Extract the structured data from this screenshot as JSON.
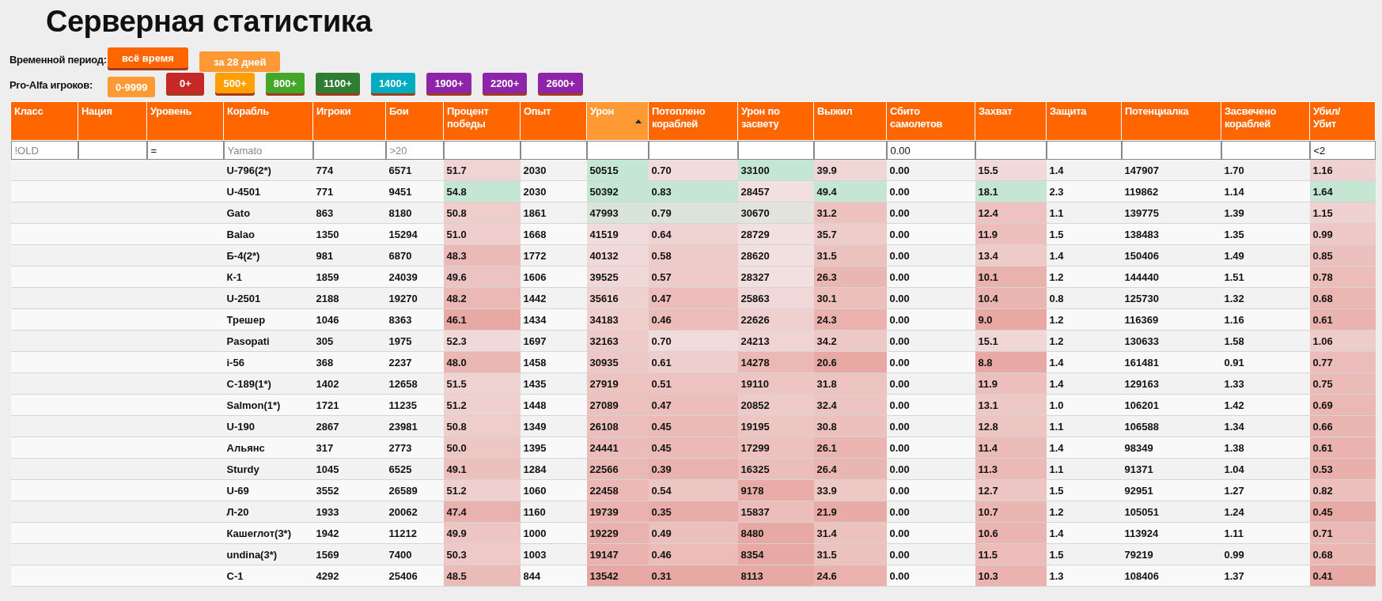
{
  "title": "Серверная статистика",
  "period": {
    "label": "Временной период:",
    "buttons": [
      {
        "label": "всё время",
        "color": "#ff6600",
        "selected": false
      },
      {
        "label": "за 28 дней",
        "color": "#ff9933",
        "selected": true
      }
    ]
  },
  "pro_alfa": {
    "label": "Pro-Alfa игроков:",
    "buttons": [
      {
        "label": "0-9999",
        "color": "#ff9933",
        "selected": true
      },
      {
        "label": "0+",
        "color": "#c62828",
        "selected": false
      },
      {
        "label": "500+",
        "color": "#ffa000",
        "selected": false
      },
      {
        "label": "800+",
        "color": "#43a82a",
        "selected": false
      },
      {
        "label": "1100+",
        "color": "#2e7d32",
        "selected": false
      },
      {
        "label": "1400+",
        "color": "#00acc1",
        "selected": false
      },
      {
        "label": "1900+",
        "color": "#8e24aa",
        "selected": false
      },
      {
        "label": "2200+",
        "color": "#8e24aa",
        "selected": false
      },
      {
        "label": "2600+",
        "color": "#8e24aa",
        "selected": false
      }
    ]
  },
  "table": {
    "columns": [
      {
        "label": "Класс",
        "sorted": false,
        "filter": {
          "placeholder": "!OLD"
        }
      },
      {
        "label": "Нация",
        "sorted": false
      },
      {
        "label": "Уровень",
        "sorted": false,
        "filter": {
          "value": "="
        }
      },
      {
        "label": "Корабль",
        "sorted": false,
        "filter": {
          "placeholder": "Yamato"
        }
      },
      {
        "label": "Игроки",
        "sorted": false
      },
      {
        "label": "Бои",
        "sorted": false,
        "filter": {
          "placeholder": ">20"
        }
      },
      {
        "label": "Процент победы",
        "sorted": false,
        "heatmap": true
      },
      {
        "label": "Опыт",
        "sorted": false
      },
      {
        "label": "Урон",
        "sorted": true,
        "heatmap": true
      },
      {
        "label": "Потоплено кораблей",
        "sorted": false,
        "heatmap": true
      },
      {
        "label": "Урон по засвету",
        "sorted": false,
        "heatmap": true
      },
      {
        "label": "Выжил",
        "sorted": false,
        "heatmap": true
      },
      {
        "label": "Сбито самолетов",
        "sorted": false,
        "filter": {
          "value": "0.00"
        }
      },
      {
        "label": "Захват",
        "sorted": false,
        "heatmap": true
      },
      {
        "label": "Защита",
        "sorted": false
      },
      {
        "label": "Потенциалка",
        "sorted": false
      },
      {
        "label": "Засвечено кораблей",
        "sorted": false
      },
      {
        "label": "Убил/ Убит",
        "sorted": false,
        "heatmap": true,
        "filter": {
          "value": "<2"
        }
      }
    ],
    "rows": [
      [
        "",
        "",
        "",
        "U-796(2*)",
        "774",
        "6571",
        "51.7",
        "2030",
        "50515",
        "0.70",
        "33100",
        "39.9",
        "0.00",
        "15.5",
        "1.4",
        "147907",
        "1.70",
        "1.16"
      ],
      [
        "",
        "",
        "",
        "U-4501",
        "771",
        "9451",
        "54.8",
        "2030",
        "50392",
        "0.83",
        "28457",
        "49.4",
        "0.00",
        "18.1",
        "2.3",
        "119862",
        "1.14",
        "1.64"
      ],
      [
        "",
        "",
        "",
        "Gato",
        "863",
        "8180",
        "50.8",
        "1861",
        "47993",
        "0.79",
        "30670",
        "31.2",
        "0.00",
        "12.4",
        "1.1",
        "139775",
        "1.39",
        "1.15"
      ],
      [
        "",
        "",
        "",
        "Balao",
        "1350",
        "15294",
        "51.0",
        "1668",
        "41519",
        "0.64",
        "28729",
        "35.7",
        "0.00",
        "11.9",
        "1.5",
        "138483",
        "1.35",
        "0.99"
      ],
      [
        "",
        "",
        "",
        "Б-4(2*)",
        "981",
        "6870",
        "48.3",
        "1772",
        "40132",
        "0.58",
        "28620",
        "31.5",
        "0.00",
        "13.4",
        "1.4",
        "150406",
        "1.49",
        "0.85"
      ],
      [
        "",
        "",
        "",
        "К-1",
        "1859",
        "24039",
        "49.6",
        "1606",
        "39525",
        "0.57",
        "28327",
        "26.3",
        "0.00",
        "10.1",
        "1.2",
        "144440",
        "1.51",
        "0.78"
      ],
      [
        "",
        "",
        "",
        "U-2501",
        "2188",
        "19270",
        "48.2",
        "1442",
        "35616",
        "0.47",
        "25863",
        "30.1",
        "0.00",
        "10.4",
        "0.8",
        "125730",
        "1.32",
        "0.68"
      ],
      [
        "",
        "",
        "",
        "Трешер",
        "1046",
        "8363",
        "46.1",
        "1434",
        "34183",
        "0.46",
        "22626",
        "24.3",
        "0.00",
        "9.0",
        "1.2",
        "116369",
        "1.16",
        "0.61"
      ],
      [
        "",
        "",
        "",
        "Pasopati",
        "305",
        "1975",
        "52.3",
        "1697",
        "32163",
        "0.70",
        "24213",
        "34.2",
        "0.00",
        "15.1",
        "1.2",
        "130633",
        "1.58",
        "1.06"
      ],
      [
        "",
        "",
        "",
        "i-56",
        "368",
        "2237",
        "48.0",
        "1458",
        "30935",
        "0.61",
        "14278",
        "20.6",
        "0.00",
        "8.8",
        "1.4",
        "161481",
        "0.91",
        "0.77"
      ],
      [
        "",
        "",
        "",
        "С-189(1*)",
        "1402",
        "12658",
        "51.5",
        "1435",
        "27919",
        "0.51",
        "19110",
        "31.8",
        "0.00",
        "11.9",
        "1.4",
        "129163",
        "1.33",
        "0.75"
      ],
      [
        "",
        "",
        "",
        "Salmon(1*)",
        "1721",
        "11235",
        "51.2",
        "1448",
        "27089",
        "0.47",
        "20852",
        "32.4",
        "0.00",
        "13.1",
        "1.0",
        "106201",
        "1.42",
        "0.69"
      ],
      [
        "",
        "",
        "",
        "U-190",
        "2867",
        "23981",
        "50.8",
        "1349",
        "26108",
        "0.45",
        "19195",
        "30.8",
        "0.00",
        "12.8",
        "1.1",
        "106588",
        "1.34",
        "0.66"
      ],
      [
        "",
        "",
        "",
        "Альянс",
        "317",
        "2773",
        "50.0",
        "1395",
        "24441",
        "0.45",
        "17299",
        "26.1",
        "0.00",
        "11.4",
        "1.4",
        "98349",
        "1.38",
        "0.61"
      ],
      [
        "",
        "",
        "",
        "Sturdy",
        "1045",
        "6525",
        "49.1",
        "1284",
        "22566",
        "0.39",
        "16325",
        "26.4",
        "0.00",
        "11.3",
        "1.1",
        "91371",
        "1.04",
        "0.53"
      ],
      [
        "",
        "",
        "",
        "U-69",
        "3552",
        "26589",
        "51.2",
        "1060",
        "22458",
        "0.54",
        "9178",
        "33.9",
        "0.00",
        "12.7",
        "1.5",
        "92951",
        "1.27",
        "0.82"
      ],
      [
        "",
        "",
        "",
        "Л-20",
        "1933",
        "20062",
        "47.4",
        "1160",
        "19739",
        "0.35",
        "15837",
        "21.9",
        "0.00",
        "10.7",
        "1.2",
        "105051",
        "1.24",
        "0.45"
      ],
      [
        "",
        "",
        "",
        "Кашеглот(3*)",
        "1942",
        "11212",
        "49.9",
        "1000",
        "19229",
        "0.49",
        "8480",
        "31.4",
        "0.00",
        "10.6",
        "1.4",
        "113924",
        "1.11",
        "0.71"
      ],
      [
        "",
        "",
        "",
        "undina(3*)",
        "1569",
        "7400",
        "50.3",
        "1003",
        "19147",
        "0.46",
        "8354",
        "31.5",
        "0.00",
        "11.5",
        "1.5",
        "79219",
        "0.99",
        "0.68"
      ],
      [
        "",
        "",
        "",
        "С-1",
        "4292",
        "25406",
        "48.5",
        "844",
        "13542",
        "0.31",
        "8113",
        "24.6",
        "0.00",
        "10.3",
        "1.3",
        "108406",
        "1.37",
        "0.41"
      ]
    ]
  }
}
